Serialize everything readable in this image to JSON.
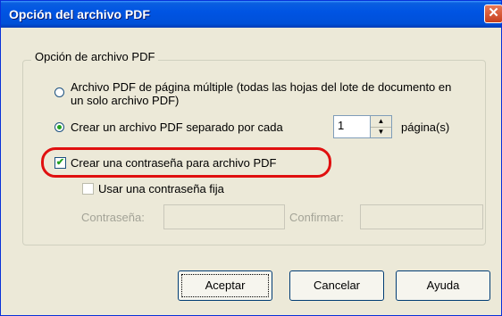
{
  "window": {
    "title": "Opción del archivo PDF",
    "close_glyph": "✕"
  },
  "group": {
    "legend": "Opción de archivo PDF",
    "option_multi": "Archivo PDF de página múltiple (todas las hojas del lote de documento en un solo archivo PDF)",
    "option_multi_selected": false,
    "option_separate": "Crear un archivo PDF separado por cada",
    "option_separate_selected": true,
    "pages_value": "1",
    "pages_suffix": "página(s)",
    "create_password_label": "Crear una contraseña para archivo PDF",
    "create_password_checked": true,
    "fixed_password_label": "Usar una contraseña fija",
    "fixed_password_checked": false,
    "password_label": "Contraseña:",
    "password_value": "",
    "confirm_label": "Confirmar:",
    "confirm_value": ""
  },
  "buttons": {
    "ok": "Aceptar",
    "cancel": "Cancelar",
    "help": "Ayuda"
  },
  "colors": {
    "highlight": "#e01010",
    "titlebar": "#0054e3",
    "face": "#ece9d8"
  }
}
